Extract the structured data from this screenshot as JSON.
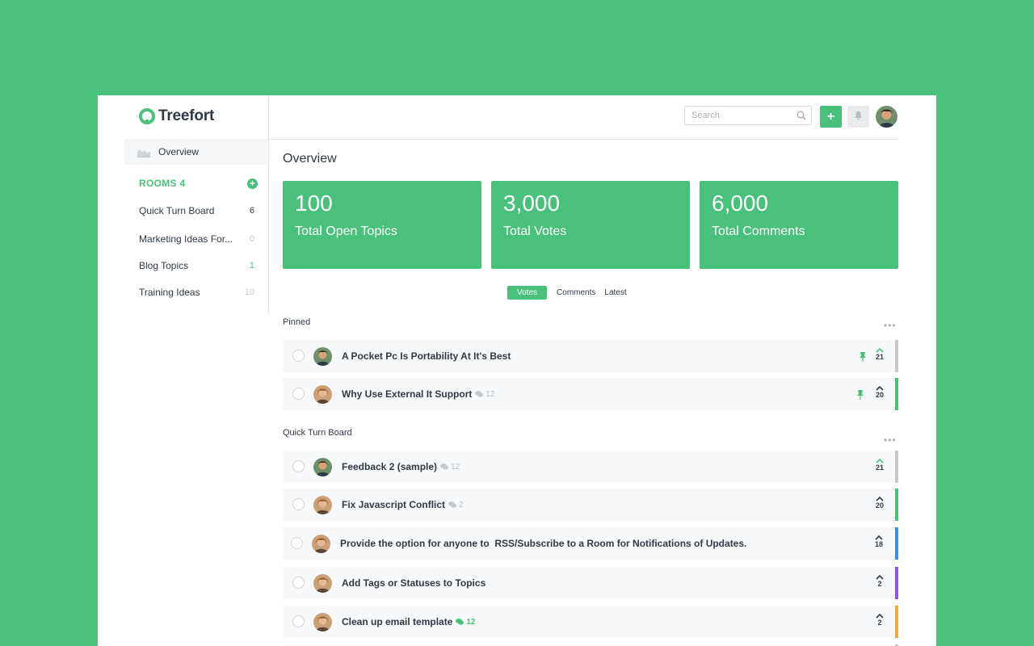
{
  "app": {
    "name": "Treefort"
  },
  "nav": {
    "overview_label": "Overview"
  },
  "rooms": {
    "title": "ROOMS 4",
    "items": [
      {
        "name": "Quick Turn Board",
        "count": "6"
      },
      {
        "name": "Marketing Ideas For...",
        "count": "0"
      },
      {
        "name": "Blog Topics",
        "count": "1"
      },
      {
        "name": "Training Ideas",
        "count": "10"
      }
    ]
  },
  "header": {
    "search_placeholder": "Search",
    "add_label": "+"
  },
  "page": {
    "title": "Overview"
  },
  "stats": [
    {
      "value": "100",
      "label": "Total Open Topics"
    },
    {
      "value": "3,000",
      "label": "Total Votes"
    },
    {
      "value": "6,000",
      "label": "Total Comments"
    }
  ],
  "tabs": [
    {
      "label": "Votes",
      "active": true
    },
    {
      "label": "Comments"
    },
    {
      "label": "Latest"
    }
  ],
  "sections": [
    {
      "title": "Pinned",
      "topics": [
        {
          "title": "A Pocket Pc Is Portability At It's Best",
          "comments": "",
          "votes": "21",
          "pinned": true,
          "vote_color": "#4ac17b",
          "bar_color": "#c5c9cc"
        },
        {
          "title": "Why Use External It Support",
          "comments": "12",
          "votes": "20",
          "pinned": true,
          "vote_color": "#2f3a45",
          "bar_color": "#4ac17b"
        }
      ]
    },
    {
      "title": "Quick Turn Board",
      "topics": [
        {
          "title": "Feedback 2 (sample)",
          "comments": "12",
          "votes": "21",
          "vote_color": "#4ac17b",
          "bar_color": "#c5c9cc"
        },
        {
          "title": "Fix Javascript Conflict",
          "comments": "2",
          "votes": "20",
          "vote_color": "#2f3a45",
          "bar_color": "#4ac17b"
        },
        {
          "title": "Provide the option for anyone to  RSS/Subscribe to a Room for Notifications of Updates.",
          "comments": "",
          "votes": "18",
          "vote_color": "#2f3a45",
          "bar_color": "#3b8fe0"
        },
        {
          "title": "Add Tags or Statuses to Topics",
          "comments": "",
          "votes": "2",
          "vote_color": "#2f3a45",
          "bar_color": "#8a55e8"
        },
        {
          "title": "Clean up email template",
          "comments": "12",
          "comments_highlight": true,
          "votes": "2",
          "vote_color": "#2f3a45",
          "bar_color": "#f0a93a"
        }
      ]
    }
  ],
  "colors": {
    "brand": "#4ac17b",
    "text": "#2f3a45",
    "muted": "#b8bdc1"
  }
}
